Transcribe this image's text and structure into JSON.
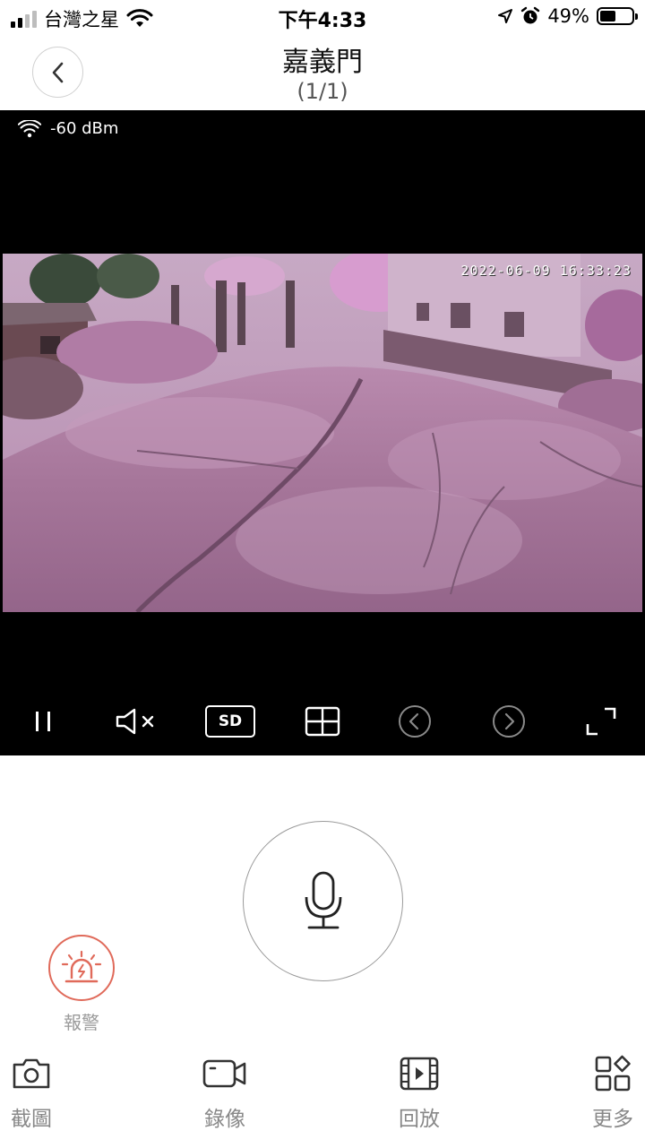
{
  "status_bar": {
    "carrier": "台灣之星",
    "time": "下午4:33",
    "battery": "49%",
    "battery_level": 0.49,
    "icons": [
      "signal-icon",
      "wifi-icon",
      "location-arrow-icon",
      "alarm-clock-icon",
      "battery-icon"
    ]
  },
  "header": {
    "title": "嘉義門",
    "subtitle": "(1/1)",
    "back_icon": "chevron-left-icon"
  },
  "video": {
    "wifi_signal": "-60 dBm",
    "timestamp": "2022-06-09 16:33:23",
    "controls": {
      "pause_icon": "pause-icon",
      "mute_icon": "speaker-muted-icon",
      "quality_label": "SD",
      "grid_icon": "grid-layout-icon",
      "prev_icon": "prev-circle-icon",
      "next_icon": "next-circle-icon",
      "fullscreen_icon": "fullscreen-icon"
    }
  },
  "talk": {
    "mic_icon": "microphone-icon"
  },
  "alarm": {
    "label": "報警",
    "icon": "siren-icon",
    "color": "#e06a5a"
  },
  "bottom_tabs": [
    {
      "label": "截圖",
      "icon": "camera-icon"
    },
    {
      "label": "錄像",
      "icon": "video-camera-icon"
    },
    {
      "label": "回放",
      "icon": "playback-film-icon"
    },
    {
      "label": "更多",
      "icon": "more-apps-icon"
    }
  ]
}
